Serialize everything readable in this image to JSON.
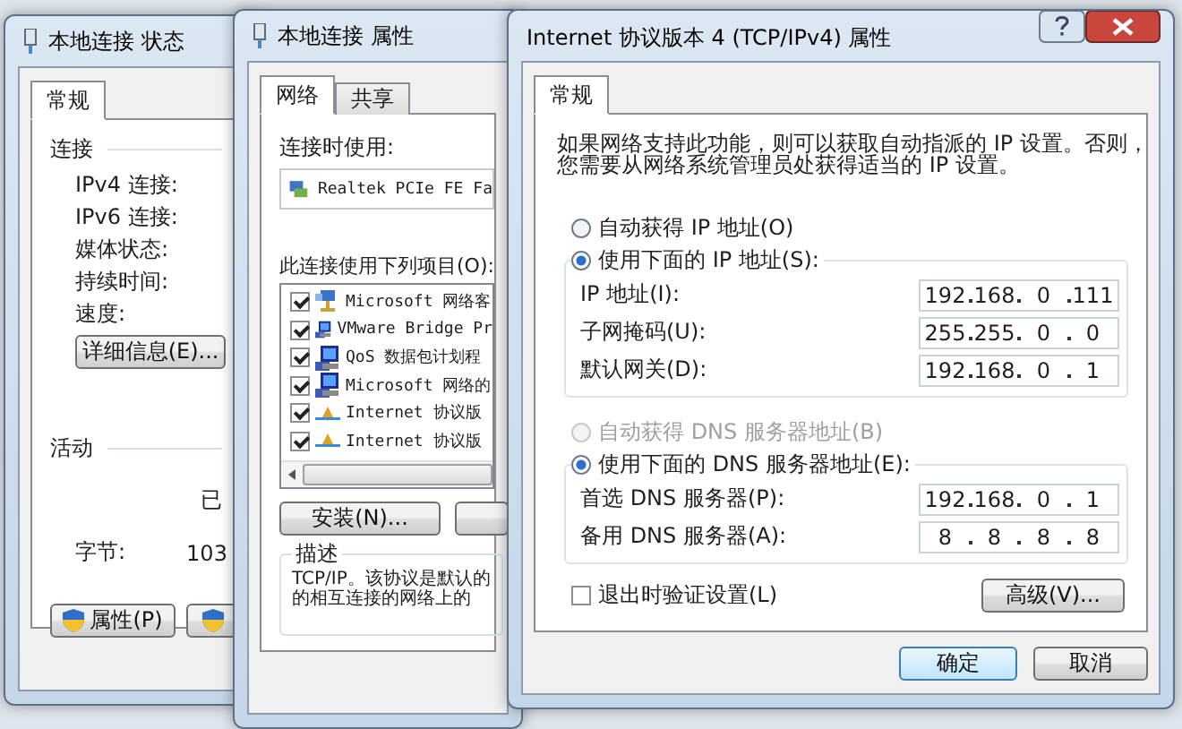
{
  "status_window": {
    "title": "本地连接 状态",
    "tabs": [
      {
        "label": "常规",
        "selected": true
      }
    ],
    "connection": {
      "heading": "连接",
      "rows": [
        "IPv4 连接:",
        "IPv6 连接:",
        "媒体状态:",
        "持续时间:",
        "速度:"
      ],
      "details_button": "详细信息(E)..."
    },
    "activity": {
      "heading": "活动",
      "sent_label": "已",
      "bytes_label": "字节:",
      "bytes_value": "103"
    },
    "properties_button": "属性(P)"
  },
  "properties_window": {
    "title": "本地连接 属性",
    "tabs": [
      {
        "label": "网络",
        "selected": true
      },
      {
        "label": "共享",
        "selected": false
      }
    ],
    "connect_using_label": "连接时使用:",
    "adapter": "Realtek PCIe FE Fa",
    "items_label": "此连接使用下列项目(O):",
    "items": [
      {
        "label": "Microsoft 网络客",
        "checked": true,
        "kind": "client"
      },
      {
        "label": "VMware Bridge Pr",
        "checked": true,
        "kind": "service"
      },
      {
        "label": "QoS 数据包计划程",
        "checked": true,
        "kind": "service"
      },
      {
        "label": "Microsoft 网络的",
        "checked": true,
        "kind": "service"
      },
      {
        "label": "Internet 协议版",
        "checked": true,
        "kind": "protocol"
      },
      {
        "label": "Internet 协议版",
        "checked": true,
        "kind": "protocol"
      }
    ],
    "install_button": "安装(N)...",
    "description_legend": "描述",
    "description_lines": [
      "TCP/IP。该协议是默认的",
      "的相互连接的网络上的"
    ]
  },
  "tcp_window": {
    "title": "Internet 协议版本 4 (TCP/IPv4) 属性",
    "tabs": [
      {
        "label": "常规",
        "selected": true
      }
    ],
    "intro_lines": [
      "如果网络支持此功能，则可以获取自动指派的 IP 设置。否则，",
      "您需要从网络系统管理员处获得适当的 IP 设置。"
    ],
    "ip_options": [
      {
        "label": "自动获得 IP 地址(O)",
        "selected": false,
        "disabled": false
      },
      {
        "label": "使用下面的 IP 地址(S):",
        "selected": true,
        "disabled": false
      }
    ],
    "ip_fields": [
      {
        "label": "IP 地址(I):",
        "octets": [
          "192",
          "168",
          "0",
          "111"
        ]
      },
      {
        "label": "子网掩码(U):",
        "octets": [
          "255",
          "255",
          "0",
          "0"
        ]
      },
      {
        "label": "默认网关(D):",
        "octets": [
          "192",
          "168",
          "0",
          "1"
        ]
      }
    ],
    "dns_options": [
      {
        "label": "自动获得 DNS 服务器地址(B)",
        "selected": false,
        "disabled": true
      },
      {
        "label": "使用下面的 DNS 服务器地址(E):",
        "selected": true,
        "disabled": false
      }
    ],
    "dns_fields": [
      {
        "label": "首选 DNS 服务器(P):",
        "octets": [
          "192",
          "168",
          "0",
          "1"
        ]
      },
      {
        "label": "备用 DNS 服务器(A):",
        "octets": [
          "8",
          "8",
          "8",
          "8"
        ]
      }
    ],
    "validate_checkbox": {
      "label": "退出时验证设置(L)",
      "checked": false
    },
    "advanced_button": "高级(V)...",
    "ok_button": "确定",
    "cancel_button": "取消"
  }
}
